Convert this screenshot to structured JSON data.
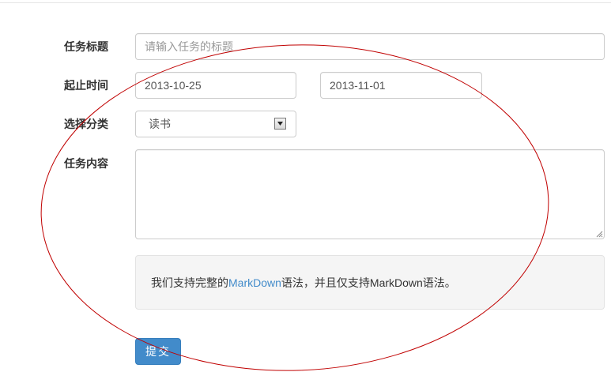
{
  "form": {
    "title_label": "任务标题",
    "title_placeholder": "请输入任务的标题",
    "title_value": "",
    "dates_label": "起止时间",
    "start_date": "2013-10-25",
    "end_date": "2013-11-01",
    "category_label": "选择分类",
    "category_selected": "读书",
    "content_label": "任务内容",
    "content_value": "",
    "help_prefix": "我们支持完整的",
    "help_link": "MarkDown",
    "help_suffix": "语法，并且仅支持MarkDown语法。",
    "submit_label": "提交"
  },
  "colors": {
    "primary": "#428bca",
    "annotation": "#c00000"
  }
}
